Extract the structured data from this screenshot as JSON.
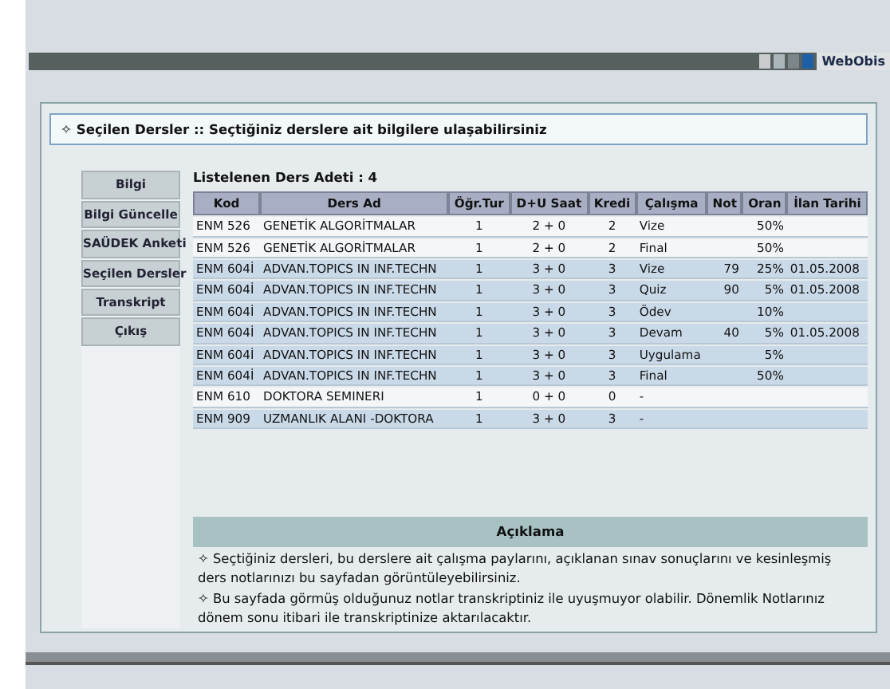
{
  "topbar": {
    "brand": "WebObis"
  },
  "header": {
    "icon": "✧",
    "text": "Seçilen Dersler :: Seçtiğiniz derslere ait bilgilere ulaşabilirsiniz"
  },
  "sidebar": {
    "items": [
      {
        "label": "Bilgi"
      },
      {
        "label": "Bilgi Güncelle"
      },
      {
        "label": "SAÜDEK Anketi"
      },
      {
        "label": "Seçilen Dersler"
      },
      {
        "label": "Transkript"
      },
      {
        "label": "Çıkış"
      }
    ]
  },
  "course_count": "Listelenen Ders Adeti : 4",
  "table": {
    "columns": [
      "Kod",
      "Ders Ad",
      "Öğr.Tur",
      "D+U Saat",
      "Kredi",
      "Çalışma",
      "Not",
      "Oran",
      "İlan Tarihi"
    ],
    "rows": [
      {
        "highlighted": false,
        "cells": [
          "ENM 526",
          "GENETİK ALGORİTMALAR",
          "1",
          "2 + 0",
          "2",
          "Vize",
          "",
          "50%",
          ""
        ]
      },
      {
        "highlighted": false,
        "cells": [
          "ENM 526",
          "GENETİK ALGORİTMALAR",
          "1",
          "2 + 0",
          "2",
          "Final",
          "",
          "50%",
          ""
        ]
      },
      {
        "highlighted": true,
        "cells": [
          "ENM 604İ",
          "ADVAN.TOPICS IN INF.TECHN",
          "1",
          "3 + 0",
          "3",
          "Vize",
          "79",
          "25%",
          "01.05.2008"
        ]
      },
      {
        "highlighted": true,
        "cells": [
          "ENM 604İ",
          "ADVAN.TOPICS IN INF.TECHN",
          "1",
          "3 + 0",
          "3",
          "Quiz",
          "90",
          "5%",
          "01.05.2008"
        ]
      },
      {
        "highlighted": true,
        "cells": [
          "ENM 604İ",
          "ADVAN.TOPICS IN INF.TECHN",
          "1",
          "3 + 0",
          "3",
          "Ödev",
          "",
          "10%",
          ""
        ]
      },
      {
        "highlighted": true,
        "cells": [
          "ENM 604İ",
          "ADVAN.TOPICS IN INF.TECHN",
          "1",
          "3 + 0",
          "3",
          "Devam",
          "40",
          "5%",
          "01.05.2008"
        ]
      },
      {
        "highlighted": true,
        "cells": [
          "ENM 604İ",
          "ADVAN.TOPICS IN INF.TECHN",
          "1",
          "3 + 0",
          "3",
          "Uygulama",
          "",
          "5%",
          ""
        ]
      },
      {
        "highlighted": true,
        "cells": [
          "ENM 604İ",
          "ADVAN.TOPICS IN INF.TECHN",
          "1",
          "3 + 0",
          "3",
          "Final",
          "",
          "50%",
          ""
        ]
      },
      {
        "highlighted": false,
        "cells": [
          "ENM 610",
          "DOKTORA SEMINERI",
          "1",
          "0 + 0",
          "0",
          "-",
          "",
          "",
          ""
        ]
      },
      {
        "highlighted": true,
        "cells": [
          "ENM 909",
          "UZMANLIK ALANI -DOKTORA",
          "1",
          "3 + 0",
          "3",
          "-",
          "",
          "",
          ""
        ]
      }
    ]
  },
  "notes": {
    "title": "Açıklama",
    "paragraphs": [
      "✧ Seçtiğiniz dersleri, bu derslere ait çalışma paylarını, açıklanan sınav sonuçlarını ve kesinleşmiş ders notlarınızı bu sayfadan görüntüleyebilirsiniz.",
      "✧ Bu sayfada görmüş olduğunuz notlar transkriptiniz ile uyuşmuyor olabilir. Dönemlik Notlarınız dönem sonu itibari ile transkriptinize aktarılacaktır."
    ]
  }
}
